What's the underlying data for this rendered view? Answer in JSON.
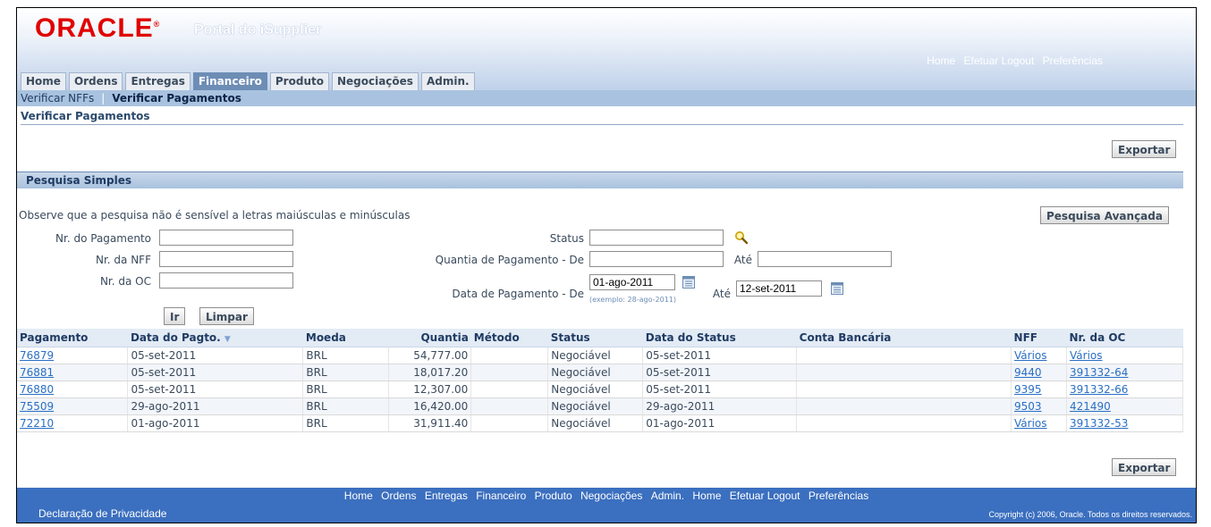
{
  "header": {
    "brand": "ORACLE",
    "portal_title": "Portal do iSupplier",
    "global_links": [
      "Home",
      "Efetuar Logout",
      "Preferências"
    ]
  },
  "tabs": [
    "Home",
    "Ordens",
    "Entregas",
    "Financeiro",
    "Produto",
    "Negociações",
    "Admin."
  ],
  "active_tab": "Financeiro",
  "subnav": {
    "items": [
      "Verificar NFFs",
      "Verificar Pagamentos"
    ],
    "active": "Verificar Pagamentos"
  },
  "page_title": "Verificar Pagamentos",
  "export_label": "Exportar",
  "search": {
    "section_title": "Pesquisa Simples",
    "note": "Observe que a pesquisa não é sensível a letras maiúsculas e minúsculas",
    "advanced_label": "Pesquisa Avançada",
    "labels": {
      "payment_number": "Nr. do Pagamento",
      "nff_number": "Nr. da NFF",
      "po_number": "Nr. da OC",
      "status": "Status",
      "amount_from": "Quantia de Pagamento - De",
      "amount_to": "Até",
      "date_from": "Data de Pagamento - De",
      "date_to": "Até"
    },
    "values": {
      "payment_number": "",
      "nff_number": "",
      "po_number": "",
      "status": "",
      "amount_from": "",
      "amount_to": "",
      "date_from": "01-ago-2011",
      "date_to": "12-set-2011"
    },
    "date_hint": "(exemplo: 28-ago-2011)",
    "go_label": "Ir",
    "clear_label": "Limpar"
  },
  "table": {
    "columns": [
      "Pagamento",
      "Data do Pagto.",
      "Moeda",
      "Quantia",
      "Método",
      "Status",
      "Data do Status",
      "Conta Bancária",
      "NFF",
      "Nr. da OC"
    ],
    "sort_indicator": "▼",
    "rows": [
      {
        "payment": "76879",
        "date": "05-set-2011",
        "currency": "BRL",
        "amount": "54,777.00",
        "method": "",
        "status": "Negociável",
        "status_date": "05-set-2011",
        "bank": "",
        "nff": "Vários",
        "po": "Vários"
      },
      {
        "payment": "76881",
        "date": "05-set-2011",
        "currency": "BRL",
        "amount": "18,017.20",
        "method": "",
        "status": "Negociável",
        "status_date": "05-set-2011",
        "bank": "",
        "nff": "9440",
        "po": "391332-64"
      },
      {
        "payment": "76880",
        "date": "05-set-2011",
        "currency": "BRL",
        "amount": "12,307.00",
        "method": "",
        "status": "Negociável",
        "status_date": "05-set-2011",
        "bank": "",
        "nff": "9395",
        "po": "391332-66"
      },
      {
        "payment": "75509",
        "date": "29-ago-2011",
        "currency": "BRL",
        "amount": "16,420.00",
        "method": "",
        "status": "Negociável",
        "status_date": "29-ago-2011",
        "bank": "",
        "nff": "9503",
        "po": "421490"
      },
      {
        "payment": "72210",
        "date": "01-ago-2011",
        "currency": "BRL",
        "amount": "31,911.40",
        "method": "",
        "status": "Negociável",
        "status_date": "01-ago-2011",
        "bank": "",
        "nff": "Vários",
        "po": "391332-53"
      }
    ]
  },
  "footer": {
    "links": [
      "Home",
      "Ordens",
      "Entregas",
      "Financeiro",
      "Produto",
      "Negociações",
      "Admin.",
      "Home",
      "Efetuar Logout",
      "Preferências"
    ],
    "privacy": "Declaração de Privacidade",
    "copyright": "Copyright (c) 2006, Oracle. Todos os direitos reservados."
  },
  "colors": {
    "brand_red": "#e00000",
    "tab_active": "#6d8db5",
    "footer_bg": "#3b6fbf",
    "link": "#2a6fc4"
  },
  "icons": {
    "status_lookup": "search-icon",
    "date_picker": "calendar-icon"
  }
}
